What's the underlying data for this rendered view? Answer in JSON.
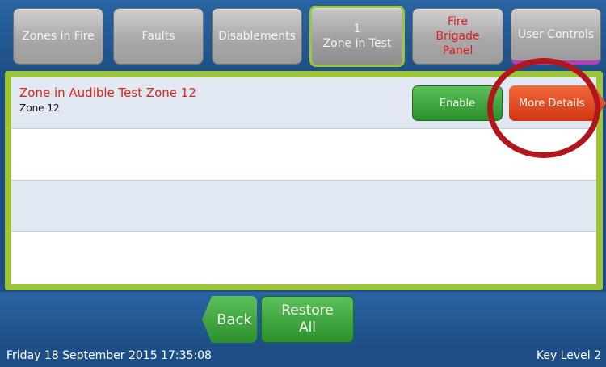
{
  "tabs": {
    "zones_in_fire": "Zones in Fire",
    "faults": "Faults",
    "disablements": "Disablements",
    "zone_in_test_count": "1",
    "zone_in_test_label": "Zone in Test",
    "fire_brigade_line1": "Fire",
    "fire_brigade_line2": "Brigade",
    "fire_brigade_line3": "Panel",
    "user_controls": "User Controls"
  },
  "list": {
    "rows": [
      {
        "title": "Zone in Audible Test Zone 12",
        "subtitle": "Zone 12",
        "enable_label": "Enable",
        "more_details_label": "More Details"
      }
    ]
  },
  "bottom": {
    "back_label": "Back",
    "restore_line1": "Restore",
    "restore_line2": "All"
  },
  "status": {
    "datetime": "Friday 18 September 2015 17:35:08",
    "key_level": "Key Level 2"
  },
  "colors": {
    "accent_green": "#9cc53c",
    "alert_red": "#d9261c",
    "header_blue": "#1d4f86",
    "highlight_ring": "#b0161b"
  }
}
